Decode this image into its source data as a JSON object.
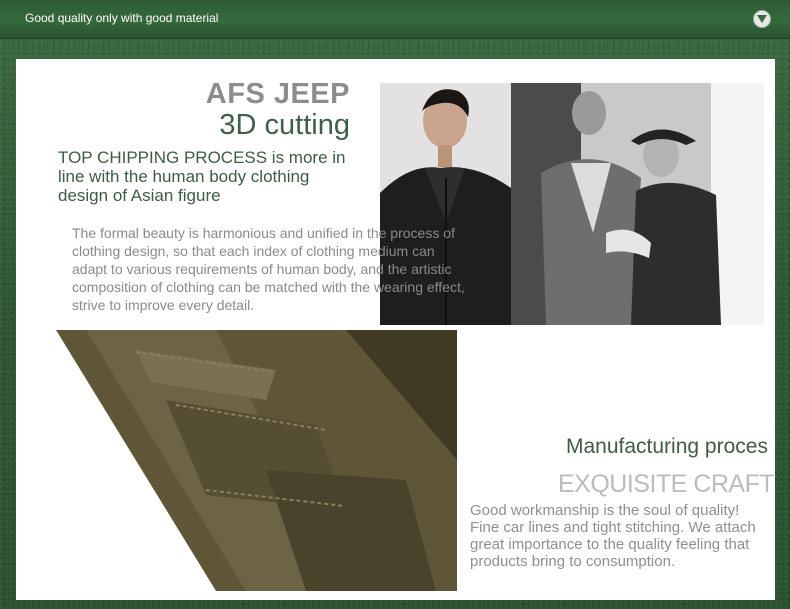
{
  "header": {
    "title": "Good quality only with good material",
    "toggle_icon": "chevron-down-icon"
  },
  "section1": {
    "brand": "AFS JEEP",
    "subtitle": "3D cutting",
    "process": "TOP CHIPPING PROCESS is more in line with the human body clothing design of Asian figure",
    "description": "The formal beauty is harmonious and unified in the process of clothing design, so that each index of clothing medium can adapt to various requirements of human body, and the artistic composition of clothing can be matched with the wearing effect, strive to improve every detail."
  },
  "section2": {
    "title": "Manufacturing proces",
    "craft": "EXQUISITE CRAFT",
    "description": "Good workmanship is the soul of quality! Fine car lines and tight stitching. We attach great importance to the quality feeling that products bring to consumption."
  },
  "colors": {
    "background": "#2f5634",
    "accent_green": "#3e5d44",
    "panel": "#ffffff"
  }
}
